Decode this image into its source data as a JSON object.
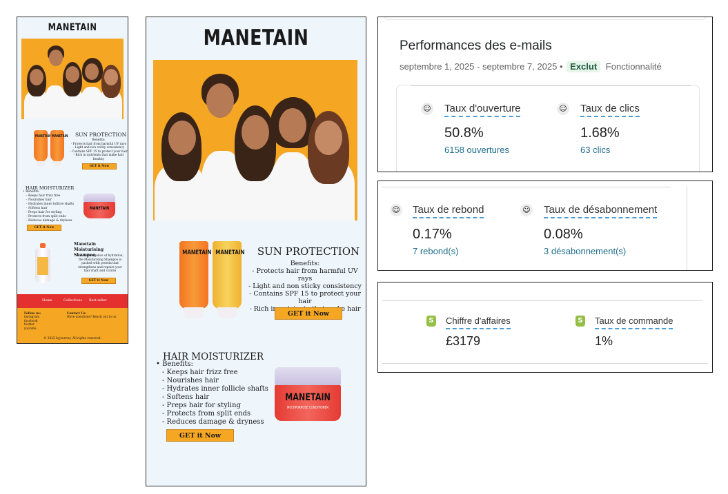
{
  "small_email": {
    "logo": "MANETAIN",
    "sun": {
      "title": "SUN PROTECTION",
      "benefits_label": "Benefits:",
      "lines": [
        "- Protects hair from harmful UV rays",
        "- Light and non sticky consistency",
        "- Contains SPF 15 to protect your hair",
        "- Rich in nutrients that make hair",
        "healthy"
      ],
      "cta": "GET it Now"
    },
    "moist": {
      "title": "HAIR MOISTURIZER",
      "benefits_label": "• Benefits:",
      "lines": [
        "- Keeps hair frizz free",
        "- Nourishes hair",
        "- Hydrates inner follicle shafts",
        "- Softens hair",
        "- Preps hair for styling",
        "- Protects from split ends",
        "- Reduces damage & dryness"
      ],
      "cta": "GET it Now"
    },
    "shampoo": {
      "title": "Manetain Moisturising Shampoo",
      "lines": [
        "A rich indulgence of hydration,",
        "the Moisturising Shampoo is",
        "packed with protein that",
        "strengthens and repairs your",
        "hair shaft and cuticle"
      ],
      "cta": "GET it Now"
    },
    "nav": [
      "Home",
      "Collections",
      "Best seller"
    ],
    "follow": [
      "Follow us:",
      "instagram",
      "facebook",
      "twitter",
      "youtube"
    ],
    "contact": [
      "Contact Us:",
      "Have questions? Reach out to us"
    ],
    "copyright": "© 2025 byjourney. All rights reserved."
  },
  "large_email": {
    "logo": "MANETAIN",
    "sun": {
      "title": "SUN PROTECTION",
      "benefits_label": "Benefits:",
      "lines": [
        "- Protects hair from harmful UV rays",
        "- Light and non sticky consistency",
        "- Contains SPF 15 to protect your hair",
        "- Rich in nutrients that make hair",
        "healthy"
      ],
      "cta": "GET it Now"
    },
    "moist": {
      "title": "HAIR MOISTURIZER",
      "benefits_label": "• Benefits:",
      "lines": [
        "- Keeps hair frizz free",
        "- Nourishes hair",
        "- Hydrates inner follicle shafts",
        "- Softens hair",
        "- Preps hair for styling",
        "- Protects from split ends",
        "- Reduces damage & dryness"
      ],
      "cta": "GET it Now"
    },
    "jar_label": "MANETAIN",
    "jar_sub": "MULTIPURPOSE CONDITIONER",
    "tube_label": "MANETAIN"
  },
  "email_perf": {
    "title": "Performances des e-mails",
    "date_range": "septembre 1, 2025 - septembre 7, 2025 •",
    "badge": "Exclut",
    "feature": "Fonctionnalité",
    "metrics": [
      {
        "label": "Taux d'ouverture",
        "value": "50.8%",
        "sub": "6158 ouvertures",
        "icon": "mailchimp-icon"
      },
      {
        "label": "Taux de clics",
        "value": "1.68%",
        "sub": "63 clics",
        "icon": "mailchimp-icon"
      }
    ]
  },
  "bounce": {
    "metrics": [
      {
        "label": "Taux de rebond",
        "value": "0.17%",
        "sub": "7 rebond(s)",
        "icon": "mailchimp-icon"
      },
      {
        "label": "Taux de désabonnement",
        "value": "0.08%",
        "sub": "3 désabonnement(s)",
        "icon": "mailchimp-icon"
      }
    ]
  },
  "sales": {
    "metrics": [
      {
        "label": "Chiffre d'affaires",
        "value": "£3179",
        "icon": "shopify-icon"
      },
      {
        "label": "Taux de commande",
        "value": "1%",
        "icon": "shopify-icon"
      }
    ]
  },
  "colors": {
    "accent_orange": "#f5a623",
    "nav_red": "#e4312f",
    "link_teal": "#1f6e8c",
    "badge_green": "#e6f4ea",
    "email_bg": "#eef6fc"
  }
}
